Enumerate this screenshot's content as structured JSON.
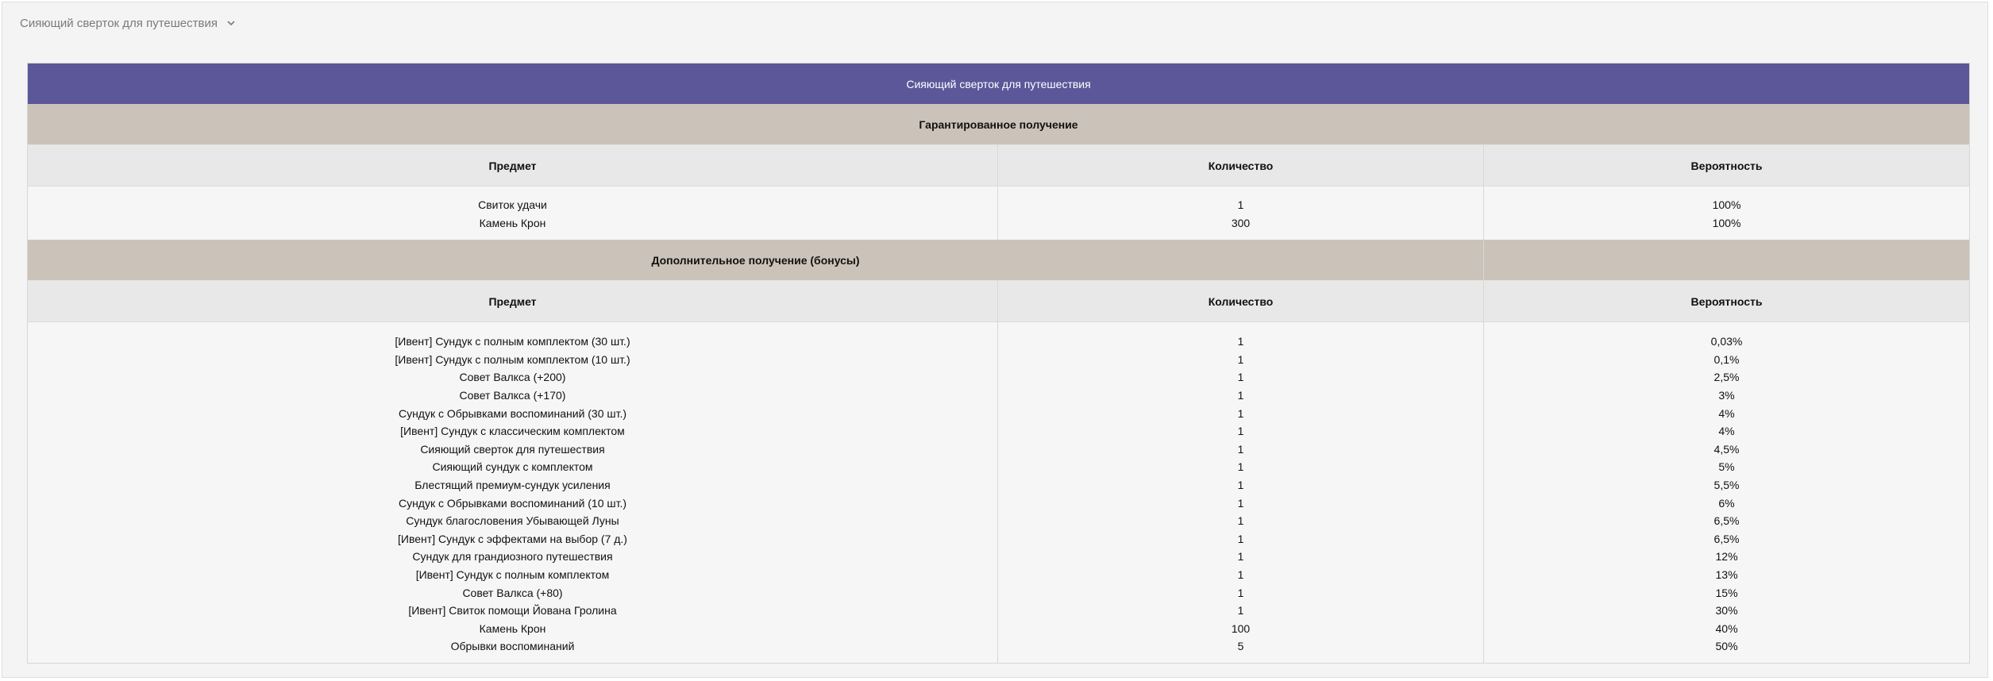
{
  "header": {
    "title": "Сияющий сверток для путешествия"
  },
  "table": {
    "title": "Сияющий сверток для путешествия",
    "guaranteed": {
      "title": "Гарантированное получение",
      "columns": [
        "Предмет",
        "Количество",
        "Вероятность"
      ],
      "items": [
        {
          "name": "Свиток удачи",
          "qty": "1",
          "prob": "100%"
        },
        {
          "name": "Камень Крон",
          "qty": "300",
          "prob": "100%"
        }
      ]
    },
    "bonus": {
      "title": "Дополнительное получение (бонусы)",
      "columns": [
        "Предмет",
        "Количество",
        "Вероятность"
      ],
      "items": [
        {
          "name": "[Ивент] Сундук с полным комплектом (30 шт.)",
          "qty": "1",
          "prob": "0,03%"
        },
        {
          "name": "[Ивент] Сундук с полным комплектом (10 шт.)",
          "qty": "1",
          "prob": "0,1%"
        },
        {
          "name": "Совет Валкса (+200)",
          "qty": "1",
          "prob": "2,5%"
        },
        {
          "name": "Совет Валкса (+170)",
          "qty": "1",
          "prob": "3%"
        },
        {
          "name": "Сундук с Обрывками воспоминаний (30 шт.)",
          "qty": "1",
          "prob": "4%"
        },
        {
          "name": "[Ивент] Сундук с классическим комплектом",
          "qty": "1",
          "prob": "4%"
        },
        {
          "name": "Сияющий сверток для путешествия",
          "qty": "1",
          "prob": "4,5%"
        },
        {
          "name": "Сияющий сундук с комплектом",
          "qty": "1",
          "prob": "5%"
        },
        {
          "name": "Блестящий премиум-сундук усиления",
          "qty": "1",
          "prob": "5,5%"
        },
        {
          "name": "Сундук с Обрывками воспоминаний (10 шт.)",
          "qty": "1",
          "prob": "6%"
        },
        {
          "name": "Сундук благословения Убывающей Луны",
          "qty": "1",
          "prob": "6,5%"
        },
        {
          "name": "[Ивент] Сундук с эффектами на выбор (7 д.)",
          "qty": "1",
          "prob": "6,5%"
        },
        {
          "name": "Сундук для грандиозного путешествия",
          "qty": "1",
          "prob": "12%"
        },
        {
          "name": "[Ивент] Сундук с полным комплектом",
          "qty": "1",
          "prob": "13%"
        },
        {
          "name": "Совет Валкса (+80)",
          "qty": "1",
          "prob": "15%"
        },
        {
          "name": "[Ивент] Свиток помощи Йована Гролина",
          "qty": "1",
          "prob": "30%"
        },
        {
          "name": "Камень Крон",
          "qty": "100",
          "prob": "40%"
        },
        {
          "name": "Обрывки воспоминаний",
          "qty": "5",
          "prob": "50%"
        }
      ]
    }
  },
  "colors": {
    "title_bar": "#5b5799",
    "section_bar": "#cbc3b9",
    "column_header": "#e8e8e8",
    "body": "#f6f6f6",
    "panel": "#f4f4f4"
  },
  "icons": {
    "collapse": "chevron-down-icon"
  }
}
